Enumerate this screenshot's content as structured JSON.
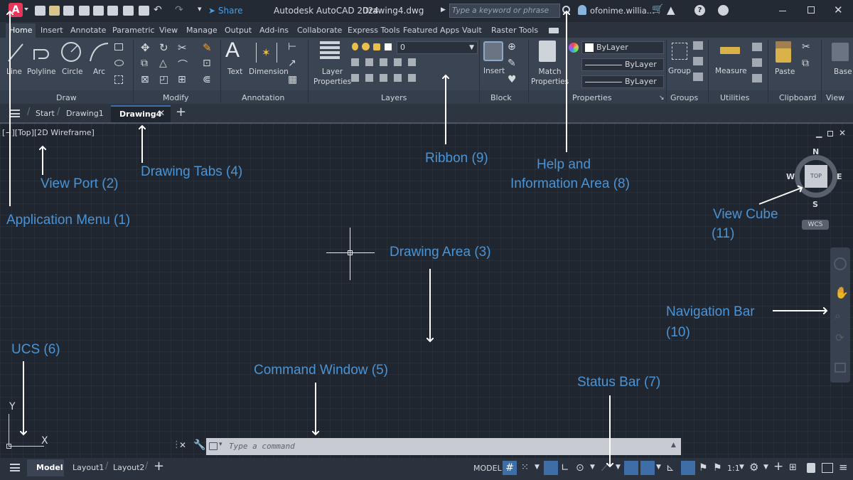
{
  "titlebar": {
    "app_letter": "A",
    "share_label": "Share",
    "app_title": "Autodesk AutoCAD 2024",
    "doc_title": "Drawing4.dwg",
    "search_placeholder": "Type a keyword or phrase",
    "user": "ofonime.willia...",
    "help_label": "?"
  },
  "ribbon_tabs": [
    "Home",
    "Insert",
    "Annotate",
    "Parametric",
    "View",
    "Manage",
    "Output",
    "Add-ins",
    "Collaborate",
    "Express Tools",
    "Featured Apps",
    "Vault",
    "Raster Tools"
  ],
  "draw_tools": [
    "Line",
    "Polyline",
    "Circle",
    "Arc"
  ],
  "annotation_tools": [
    "Text",
    "Dimension"
  ],
  "layer_properties": "Layer\nProperties",
  "layer_value": "0",
  "block_tool": "Insert",
  "match_properties": "Match\nProperties",
  "property_values": [
    "ByLayer",
    "ByLayer",
    "ByLayer"
  ],
  "group_tool": "Group",
  "measure_tool": "Measure",
  "paste_tool": "Paste",
  "base_tool": "Base",
  "panels": [
    "Draw",
    "Modify",
    "Annotation",
    "Layers",
    "Block",
    "Properties",
    "Groups",
    "Utilities",
    "Clipboard",
    "View"
  ],
  "doc_tabs": [
    "Start",
    "Drawing1",
    "Drawing4"
  ],
  "viewport_label": "[−][Top][2D Wireframe]",
  "viewcube": {
    "n": "N",
    "s": "S",
    "e": "E",
    "w": "W",
    "top": "TOP",
    "wcs": "WCS"
  },
  "ucs": {
    "y": "Y",
    "x": "X"
  },
  "command_placeholder": "Type a command",
  "layout_tabs": [
    "Model",
    "Layout1",
    "Layout2"
  ],
  "status": {
    "model": "MODEL",
    "scale": "1:1"
  },
  "annotations": {
    "app_menu": "Application Menu  (1)",
    "viewport": "View Port  (2)",
    "drawing_area": "Drawing Area  (3)",
    "drawing_tabs": "Drawing Tabs  (4)",
    "command_window": "Command Window  (5)",
    "ucs": "UCS  (6)",
    "status_bar": "Status Bar  (7)",
    "help_area_1": "Help and",
    "help_area_2": "Information Area  (8)",
    "ribbon": "Ribbon  (9)",
    "nav_bar_1": "Navigation Bar",
    "nav_bar_2": "(10)",
    "view_cube_1": "View Cube",
    "view_cube_2": "(11)"
  },
  "colors": {
    "app_button": "#e8375a",
    "annotation": "#4a94d6",
    "background": "#20262f"
  }
}
